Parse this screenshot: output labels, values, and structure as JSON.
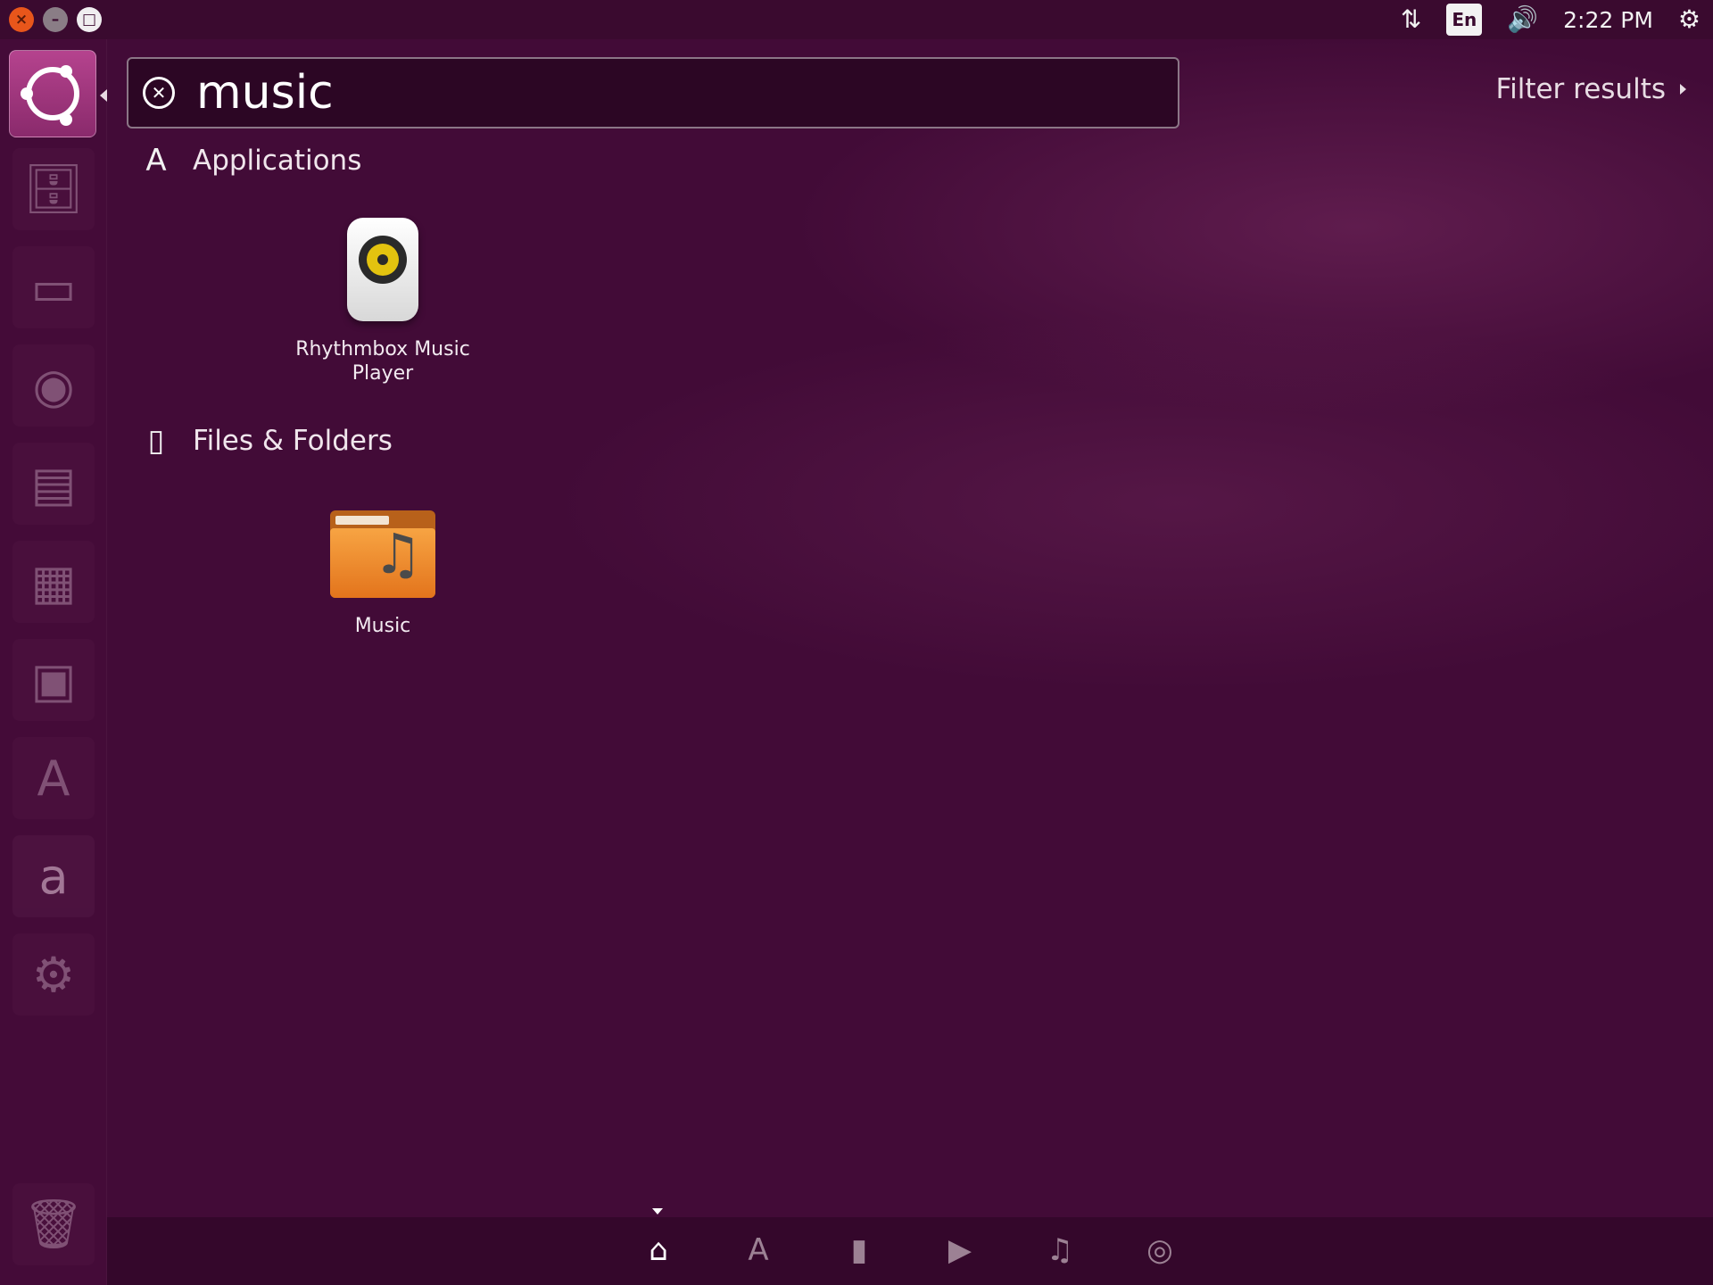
{
  "window_controls": {
    "close": "×",
    "minimize": "–",
    "maximize": "□"
  },
  "indicators": {
    "keyboard_layout": "En",
    "clock": "2:22 PM"
  },
  "launcher": {
    "items": [
      {
        "name": "dash-home",
        "icon": "ubuntu-logo-icon",
        "active": true
      },
      {
        "name": "files",
        "icon": "file-manager-icon"
      },
      {
        "name": "browser-window",
        "icon": "window-icon"
      },
      {
        "name": "firefox",
        "icon": "firefox-icon"
      },
      {
        "name": "writer",
        "icon": "document-icon"
      },
      {
        "name": "calc",
        "icon": "spreadsheet-icon"
      },
      {
        "name": "impress",
        "icon": "presentation-icon"
      },
      {
        "name": "software-center",
        "icon": "software-center-icon"
      },
      {
        "name": "amazon",
        "icon": "amazon-icon",
        "glyph": "a"
      },
      {
        "name": "system-settings",
        "icon": "settings-icon"
      },
      {
        "name": "trash",
        "icon": "trash-icon"
      }
    ]
  },
  "search": {
    "value": "music"
  },
  "filter": {
    "label": "Filter results"
  },
  "categories": [
    {
      "title": "Applications",
      "icon": "applications-icon",
      "results": [
        {
          "label": "Rhythmbox Music Player",
          "icon": "rhythmbox-icon"
        }
      ]
    },
    {
      "title": "Files & Folders",
      "icon": "file-icon",
      "results": [
        {
          "label": "Music",
          "icon": "music-folder-icon"
        }
      ]
    }
  ],
  "lenses": [
    {
      "name": "home",
      "icon": "home-icon",
      "active": true
    },
    {
      "name": "applications",
      "icon": "applications-icon"
    },
    {
      "name": "files",
      "icon": "file-icon"
    },
    {
      "name": "video",
      "icon": "video-icon"
    },
    {
      "name": "music",
      "icon": "music-note-icon"
    },
    {
      "name": "photos",
      "icon": "camera-icon"
    }
  ],
  "colors": {
    "panel": "#3a0a2f",
    "dash_background": "#420b37",
    "launcher_active": "#b5438e",
    "close_button": "#e8561b"
  }
}
